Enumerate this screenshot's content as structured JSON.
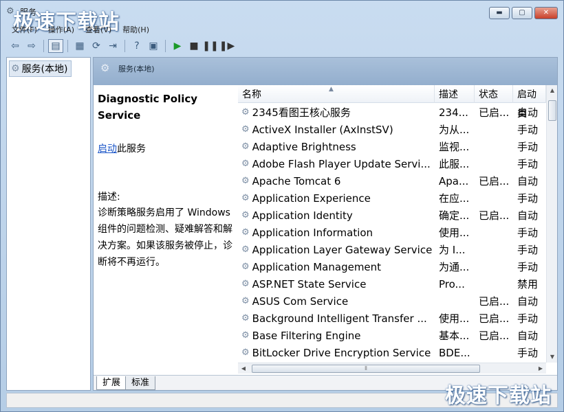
{
  "window": {
    "title": "服务",
    "watermark": "极速下载站",
    "min_label": "▬",
    "max_label": "▢",
    "close_label": "✕"
  },
  "menu": [
    "文件(F)",
    "操作(A)",
    "查看(V)",
    "帮助(H)"
  ],
  "toolbar": {
    "icons": [
      "back-icon",
      "forward-icon",
      "console-tree-icon",
      "properties-icon",
      "refresh-icon",
      "export-icon",
      "help-icon",
      "view-icon",
      "start-icon",
      "stop-icon",
      "pause-icon",
      "restart-icon"
    ]
  },
  "tree": {
    "root_label": "服务(本地)"
  },
  "pane": {
    "header_title": "服务(本地)"
  },
  "detail": {
    "service_title": "Diagnostic Policy Service",
    "start_link": "启动",
    "start_suffix": "此服务",
    "desc_label": "描述:",
    "description": "诊断策略服务启用了 Windows 组件的问题检测、疑难解答和解决方案。如果该服务被停止，诊断将不再运行。"
  },
  "list": {
    "columns": [
      "名称",
      "描述",
      "状态",
      "启动类"
    ],
    "rows": [
      {
        "name": "2345看图王核心服务",
        "desc": "234...",
        "state": "已启...",
        "start": "自动"
      },
      {
        "name": "ActiveX Installer (AxInstSV)",
        "desc": "为从...",
        "state": "",
        "start": "手动"
      },
      {
        "name": "Adaptive Brightness",
        "desc": "监视...",
        "state": "",
        "start": "手动"
      },
      {
        "name": "Adobe Flash Player Update Servi...",
        "desc": "此服...",
        "state": "",
        "start": "手动"
      },
      {
        "name": "Apache Tomcat 6",
        "desc": "Apa...",
        "state": "已启...",
        "start": "自动"
      },
      {
        "name": "Application Experience",
        "desc": "在应...",
        "state": "",
        "start": "手动"
      },
      {
        "name": "Application Identity",
        "desc": "确定...",
        "state": "已启...",
        "start": "自动"
      },
      {
        "name": "Application Information",
        "desc": "使用...",
        "state": "",
        "start": "手动"
      },
      {
        "name": "Application Layer Gateway Service",
        "desc": "为 I...",
        "state": "",
        "start": "手动"
      },
      {
        "name": "Application Management",
        "desc": "为通...",
        "state": "",
        "start": "手动"
      },
      {
        "name": "ASP.NET State Service",
        "desc": "Pro...",
        "state": "",
        "start": "禁用"
      },
      {
        "name": "ASUS Com Service",
        "desc": "",
        "state": "已启...",
        "start": "自动"
      },
      {
        "name": "Background Intelligent Transfer ...",
        "desc": "使用...",
        "state": "已启...",
        "start": "手动"
      },
      {
        "name": "Base Filtering Engine",
        "desc": "基本...",
        "state": "已启...",
        "start": "自动"
      },
      {
        "name": "BitLocker Drive Encryption Service",
        "desc": "BDE...",
        "state": "",
        "start": "手动"
      }
    ]
  },
  "tabs": [
    "扩展",
    "标准"
  ]
}
